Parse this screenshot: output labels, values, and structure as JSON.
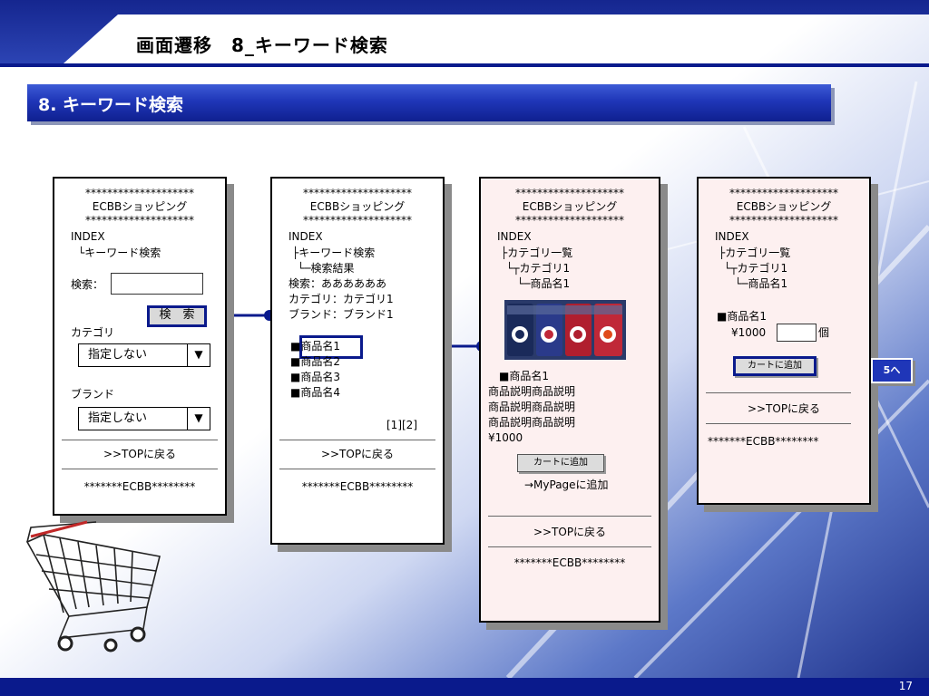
{
  "slide": {
    "title": "画面遷移　8_キーワード検索",
    "section_title": "8. キーワード検索",
    "page_number": "17",
    "goto_label": "5へ"
  },
  "colors": {
    "navy": "#0a1a8c",
    "section_blue": "#1f36b8",
    "screen_pink": "#fdf0f0"
  },
  "icons": [
    "shopping-cart-illustration",
    "product-photo"
  ],
  "common": {
    "stars": "********************",
    "shop_name": "ECBBショッピング",
    "index": "INDEX",
    "top_link": ">>TOPに戻る",
    "footer": "*******ECBB********"
  },
  "screen1": {
    "breadcrumb": "└キーワード検索",
    "search_label": "検索：",
    "search_value": "",
    "search_button": "検　索",
    "category_label": "カテゴリ",
    "category_value": "指定しない",
    "brand_label": "ブランド",
    "brand_value": "指定しない",
    "arrow": "▼"
  },
  "screen2": {
    "breadcrumb_1": "├キーワード検索",
    "breadcrumb_2": "└─検索結果",
    "query_line": "検索：ああああああ",
    "category_line": "カテゴリ：カテゴリ1",
    "brand_line": "ブランド：ブランド1",
    "results": [
      "■商品名1",
      "■商品名2",
      "■商品名3",
      "■商品名4"
    ],
    "pager": "[1][2]"
  },
  "screen3": {
    "breadcrumb_1": "├カテゴリ一覧",
    "breadcrumb_2": "└┬カテゴリ1",
    "breadcrumb_3": "└─商品名1",
    "product_title": "■商品名1",
    "desc_lines": [
      "商品説明商品説明",
      "商品説明商品説明",
      "商品説明商品説明"
    ],
    "price": "¥1000",
    "cart_button": "カートに追加",
    "mypage_link": "→MyPageに追加"
  },
  "screen4": {
    "breadcrumb_1": "├カテゴリ一覧",
    "breadcrumb_2": "└┬カテゴリ1",
    "breadcrumb_3": "└─商品名1",
    "product_title": "■商品名1",
    "price": "¥1000",
    "qty_value": "",
    "qty_unit": "個",
    "cart_button": "カートに追加"
  }
}
